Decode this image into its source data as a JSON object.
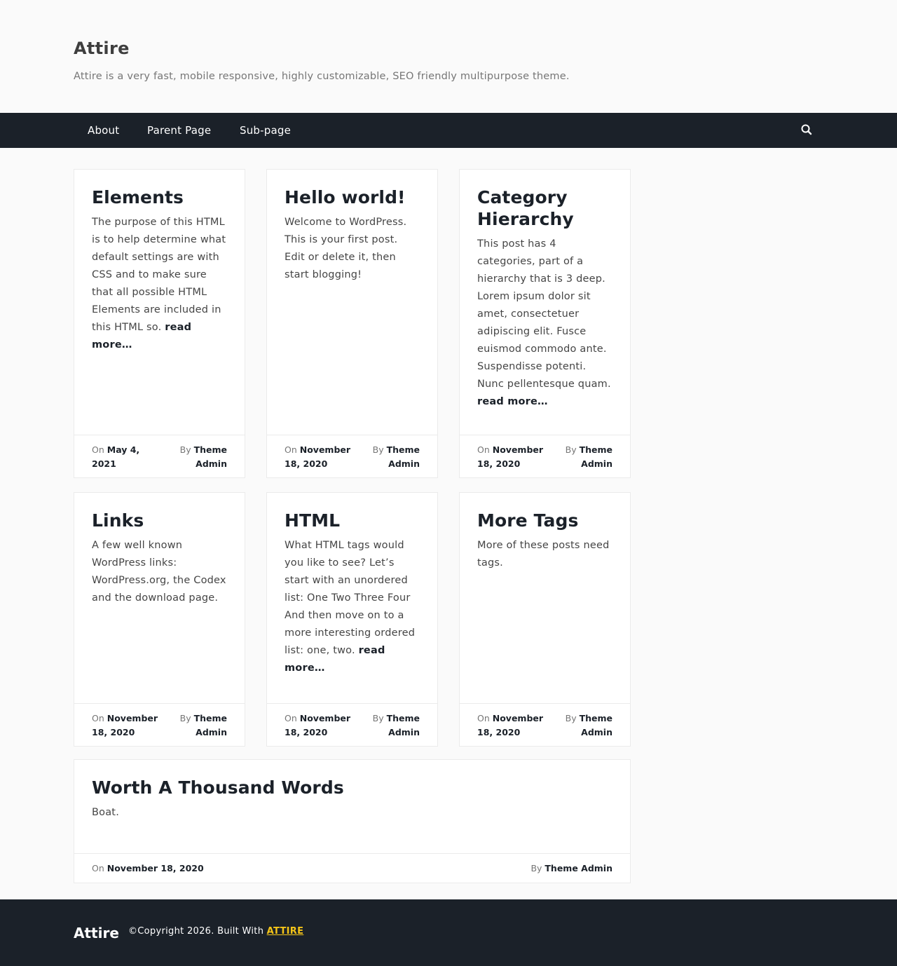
{
  "header": {
    "site_title": "Attire",
    "tagline": "Attire is a very fast, mobile responsive, highly customizable, SEO friendly multipurpose theme."
  },
  "nav": {
    "items": [
      "About",
      "Parent Page",
      "Sub-page"
    ],
    "search_icon": "search-icon"
  },
  "posts": [
    {
      "title": "Elements",
      "excerpt": "The purpose of this HTML is to help determine what default settings are with CSS and to make sure that all possible HTML Elements are included in this HTML so.",
      "read_more": "read more…",
      "on_label": "On",
      "date": "May 4, 2021",
      "by_label": "By",
      "author": "Theme Admin"
    },
    {
      "title": "Hello world!",
      "excerpt": "Welcome to WordPress. This is your first post. Edit or delete it, then start blogging!",
      "on_label": "On",
      "date": "November 18, 2020",
      "by_label": "By",
      "author": "Theme Admin"
    },
    {
      "title": "Category Hierarchy",
      "excerpt": "This post has 4 categories, part of a hierarchy that is 3 deep. Lorem ipsum dolor sit amet, consectetuer adipiscing elit. Fusce euismod commodo ante. Suspendisse potenti. Nunc pellentesque quam.",
      "read_more": "read more…",
      "on_label": "On",
      "date": "November 18, 2020",
      "by_label": "By",
      "author": "Theme Admin"
    },
    {
      "title": "Links",
      "excerpt": "A few well known WordPress links: WordPress.org, the Codex and the download page.",
      "on_label": "On",
      "date": "November 18, 2020",
      "by_label": "By",
      "author": "Theme Admin"
    },
    {
      "title": "HTML",
      "excerpt": "What HTML tags would you like to see? Let’s start with an unordered list: One Two Three Four And then move on to a more interesting ordered list: one, two.",
      "read_more": "read more…",
      "on_label": "On",
      "date": "November 18, 2020",
      "by_label": "By",
      "author": "Theme Admin"
    },
    {
      "title": "More Tags",
      "excerpt": "More of these posts need tags.",
      "on_label": "On",
      "date": "November 18, 2020",
      "by_label": "By",
      "author": "Theme Admin"
    },
    {
      "title": "Worth A Thousand Words",
      "excerpt": "Boat.",
      "on_label": "On",
      "date": "November 18, 2020",
      "by_label": "By",
      "author": "Theme Admin"
    }
  ],
  "footer": {
    "title": "Attire",
    "copyright": "©Copyright 2026. Built With",
    "link": "ATTIRE"
  }
}
